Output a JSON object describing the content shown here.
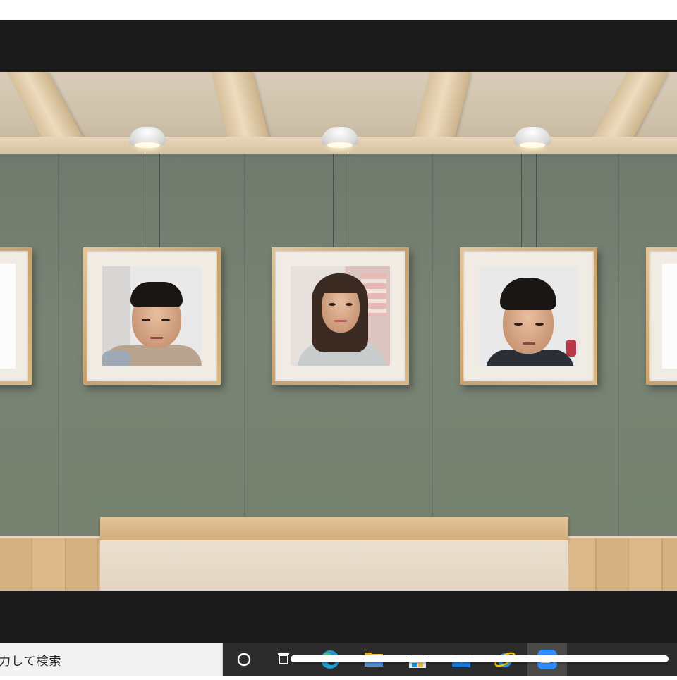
{
  "taskbar": {
    "search_placeholder": "力して検索",
    "icons": [
      "cortana-circle-icon",
      "task-view-icon",
      "edge-icon",
      "file-explorer-icon",
      "store-icon",
      "mail-icon",
      "ie-icon",
      "zoom-icon"
    ]
  },
  "gallery": {
    "frames": [
      {
        "id": "frame-1",
        "subject": "boy-portrait"
      },
      {
        "id": "frame-2",
        "subject": "woman-portrait"
      },
      {
        "id": "frame-3",
        "subject": "boy-portrait"
      }
    ]
  },
  "colors": {
    "wall": "#76816f",
    "frame_wood": "#d4ad78",
    "taskbar": "#2c2c2c",
    "letterbox": "#1b1b1b"
  }
}
